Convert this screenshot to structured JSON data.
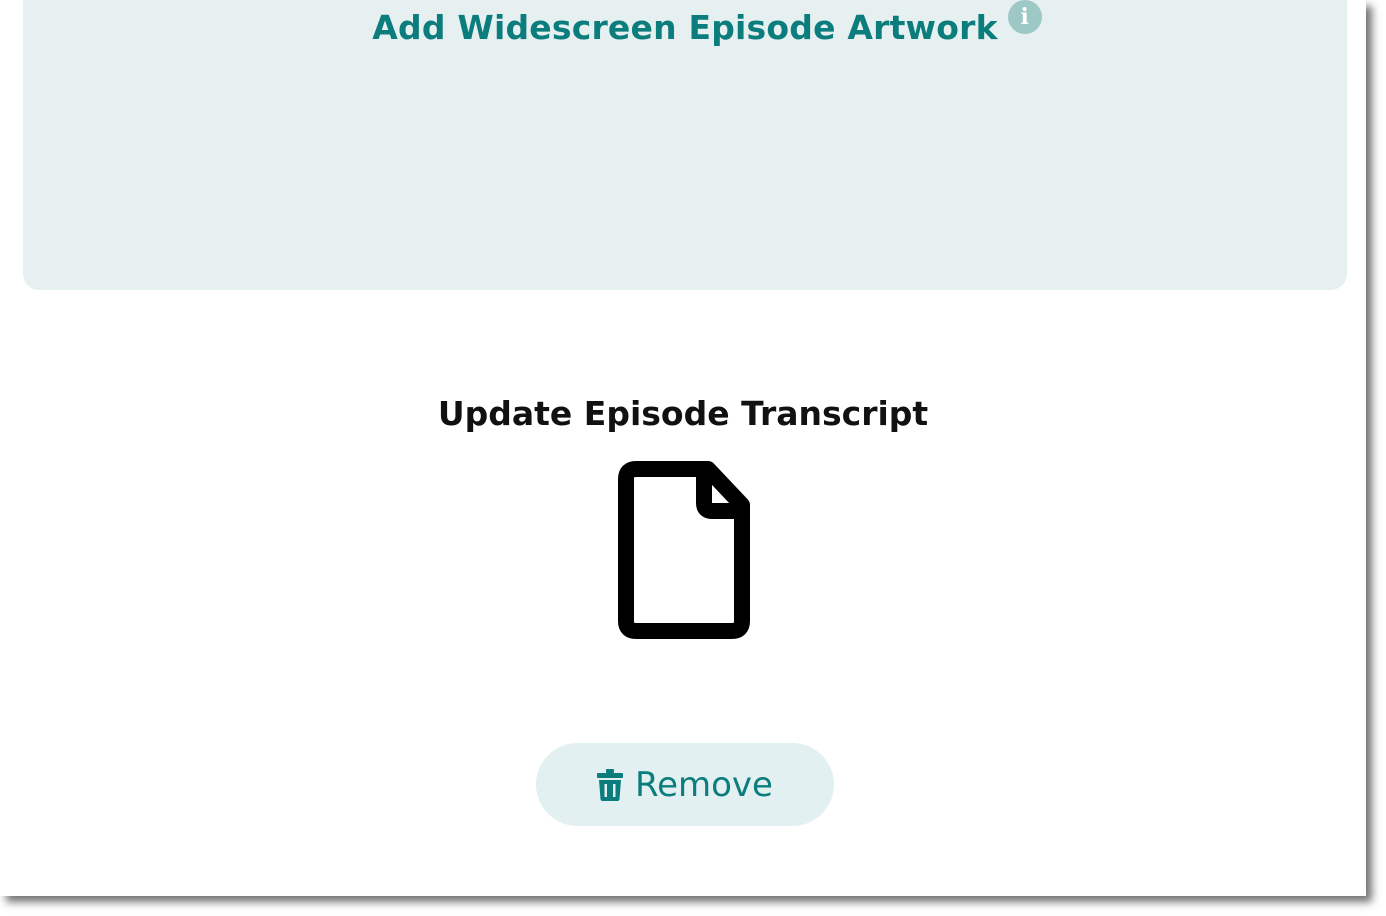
{
  "artwork": {
    "add_label": "Add Widescreen Episode Artwork",
    "info_glyph": "i"
  },
  "transcript": {
    "title": "Update Episode Transcript",
    "file_icon": "file-icon"
  },
  "remove_button": {
    "label": "Remove",
    "icon": "trash-icon"
  },
  "colors": {
    "accent": "#0b7d7d",
    "panel_bg": "#e7f0f1",
    "button_bg": "#e3f0f1",
    "info_icon_bg": "#9ec8c6"
  }
}
